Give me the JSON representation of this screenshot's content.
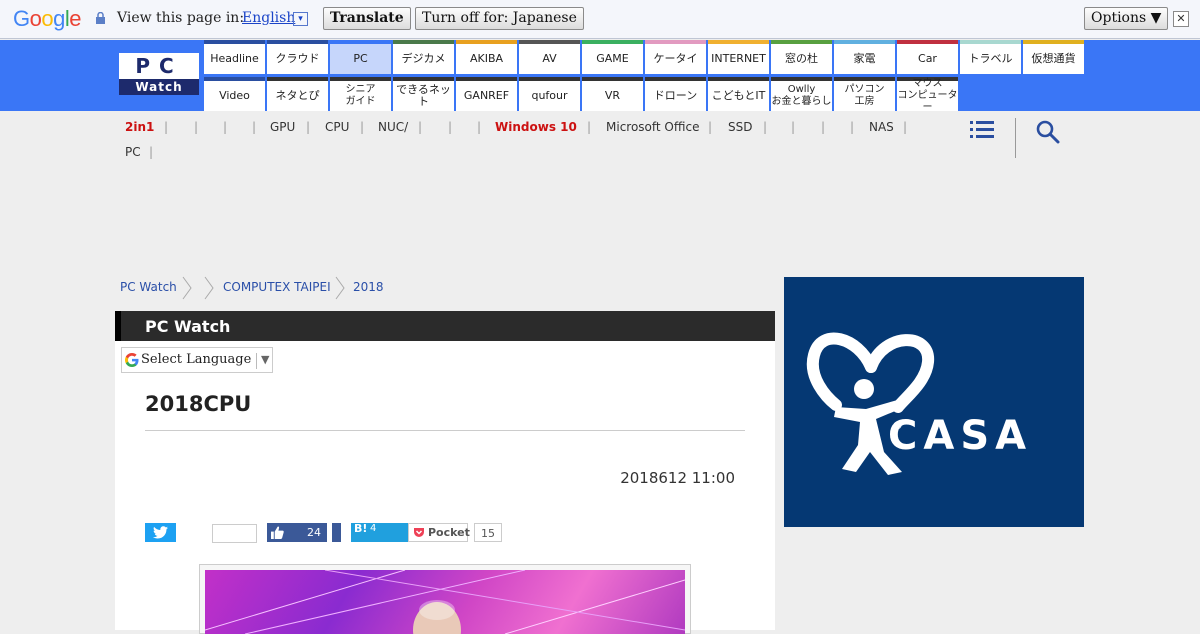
{
  "translate_bar": {
    "brand": "Google",
    "label": "View this page in:",
    "language": "English",
    "language_dropdown": "▾",
    "translate_button": "Translate",
    "turn_off_button": "Turn off for: Japanese",
    "options_button": "Options ▼",
    "close": "✕"
  },
  "site": {
    "logo_top": "PC",
    "logo_bottom": "Watch"
  },
  "nav": {
    "row1": [
      {
        "label": "Headline",
        "color": "#2a4ea0"
      },
      {
        "label": "クラウド",
        "color": "#2a4ea0"
      },
      {
        "label": "PC",
        "color": "#3a76f6"
      },
      {
        "label": "デジカメ",
        "color": "#4a7a4a"
      },
      {
        "label": "AKIBA",
        "color": "#e8a020"
      },
      {
        "label": "AV",
        "color": "#555555"
      },
      {
        "label": "GAME",
        "color": "#3ab060"
      },
      {
        "label": "ケータイ",
        "color": "#e29ac0"
      },
      {
        "label": "INTERNET",
        "color": "#f0b030"
      },
      {
        "label": "窓の杜",
        "color": "#58a040"
      },
      {
        "label": "家電",
        "color": "#60b0e0"
      },
      {
        "label": "Car",
        "color": "#c03040"
      },
      {
        "label": "トラベル",
        "color": "#a8d8d0"
      },
      {
        "label": "仮想通貨",
        "color": "#e0b020"
      }
    ],
    "row2": [
      {
        "label": "Video",
        "color": "#2a4ea0"
      },
      {
        "label": "ネタとぴ",
        "color": "#333333"
      },
      {
        "label": "シニア\nガイド",
        "color": "#333333"
      },
      {
        "label": "できるネット",
        "color": "#333333"
      },
      {
        "label": "GANREF",
        "color": "#333333"
      },
      {
        "label": "qufour",
        "color": "#333333"
      },
      {
        "label": "VR",
        "color": "#333333"
      },
      {
        "label": "ドローン",
        "color": "#333333"
      },
      {
        "label": "こどもとIT",
        "color": "#333333"
      },
      {
        "label": "Owlly\nお金と暮らし",
        "color": "#333333"
      },
      {
        "label": "パソコン\n工房",
        "color": "#333333"
      },
      {
        "label": "マウス\nコンピューター",
        "color": "#333333"
      }
    ]
  },
  "subnav": {
    "items": [
      "2in1",
      "|",
      "|",
      "|",
      "|",
      "GPU",
      "|",
      "CPU",
      "|",
      "NUC/",
      "|",
      "|",
      "|",
      "Windows 10",
      "|",
      "Microsoft Office",
      "|",
      "SSD",
      "|",
      "|",
      "|",
      "|",
      "NAS",
      "|"
    ],
    "row2": [
      "PC",
      "|"
    ],
    "highlight_color": "#cc1111"
  },
  "breadcrumb": [
    "PC Watch",
    "COMPUTEX TAIPEI",
    "2018"
  ],
  "section_title": "PC Watch",
  "select_language": {
    "label": "Select Language",
    "arrow": "▼"
  },
  "article": {
    "title": "2018CPU",
    "date": "2018612 11:00"
  },
  "share": {
    "like_count": "24",
    "hatena_label": "B!",
    "hatena_count": "4",
    "pocket_label": "Pocket",
    "pocket_count": "15"
  },
  "ad": {
    "brand": "CASA",
    "registered": "®"
  }
}
